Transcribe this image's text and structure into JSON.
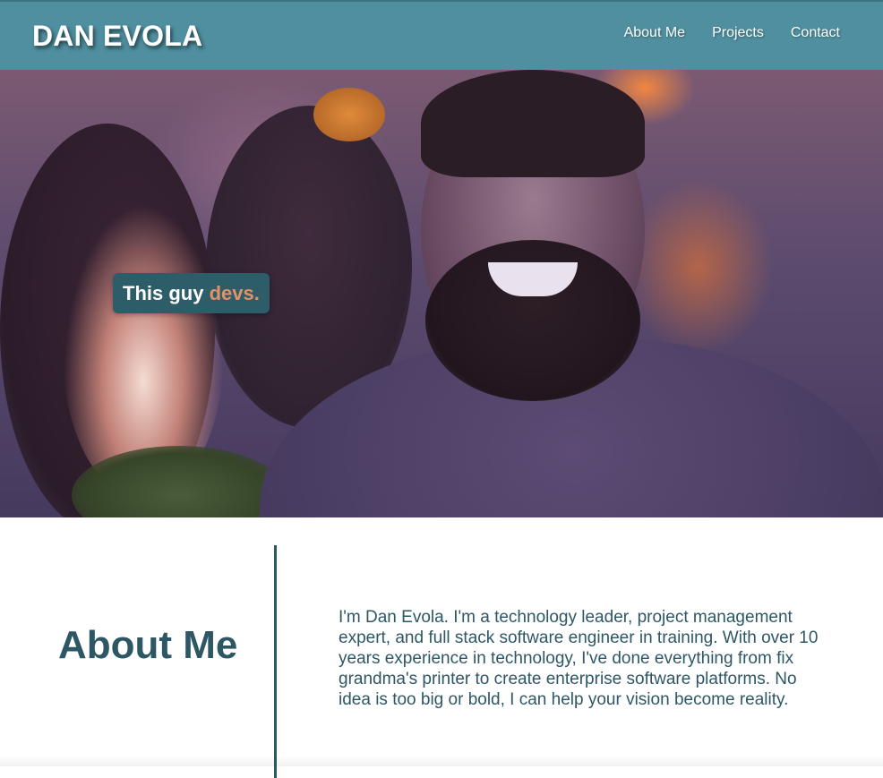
{
  "header": {
    "brand": "DAN EVOLA",
    "nav": [
      {
        "label": "About Me"
      },
      {
        "label": "Projects"
      },
      {
        "label": "Contact"
      }
    ],
    "background_color": "#4f8f9f"
  },
  "hero": {
    "tagline_prefix": "This guy ",
    "tagline_accent": "devs.",
    "tagline_accent_color": "#e29067",
    "tagline_background_color": "#2e5d6a"
  },
  "about": {
    "title": "About Me",
    "body": "I'm Dan Evola. I'm a technology leader, project management expert, and full stack software engineer in training. With over 10 years experience in technology, I've done everything from fix grandma's printer to create enterprise software platforms. No idea is too big or bold, I can help your vision become reality.",
    "text_color": "#2e5766"
  }
}
